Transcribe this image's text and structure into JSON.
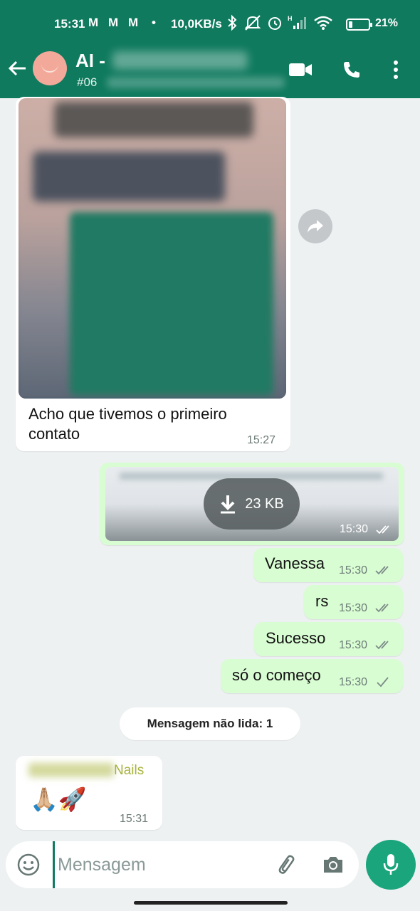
{
  "status_bar": {
    "time": "15:31",
    "mail_icons": [
      "M",
      "M",
      "M"
    ],
    "dot": "•",
    "network_speed": "10,0KB/s",
    "battery_text": "21%",
    "battery_level": 0.21
  },
  "header": {
    "title": "AI -",
    "subtitle": "#06"
  },
  "messages": {
    "image_msg": {
      "caption": "Acho que tivemos o primeiro contato",
      "time": "15:27"
    },
    "doc_msg": {
      "size": "23 KB",
      "time": "15:30"
    },
    "out": [
      {
        "text": "Vanessa",
        "time": "15:30",
        "status": "read"
      },
      {
        "text": "rs",
        "time": "15:30",
        "status": "read"
      },
      {
        "text": "Sucesso",
        "time": "15:30",
        "status": "read"
      },
      {
        "text": "só o começo",
        "time": "15:30",
        "status": "sent"
      }
    ],
    "unread_label": "Mensagem não lida: 1",
    "incoming": {
      "sender_visible": "Nails",
      "emojis": "🙏🏼🚀",
      "time": "15:31"
    }
  },
  "input": {
    "placeholder": "Mensagem"
  },
  "colors": {
    "header": "#0f7a5e",
    "outgoing_bubble": "#d9fdd3",
    "mic_button": "#1ba57d",
    "read_tick": "#6b8f98"
  }
}
